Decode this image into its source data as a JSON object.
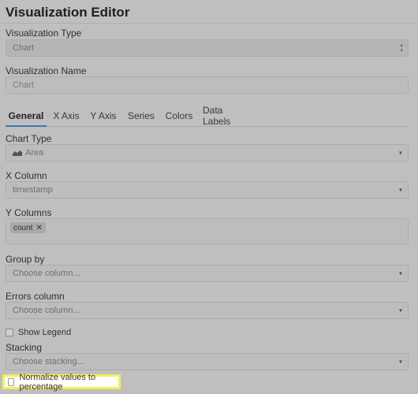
{
  "editor": {
    "title": "Visualization Editor"
  },
  "fields": {
    "viz_type_label": "Visualization Type",
    "viz_type_value": "Chart",
    "viz_name_label": "Visualization Name",
    "viz_name_placeholder": "Chart"
  },
  "tabs": [
    {
      "label": "General"
    },
    {
      "label": "X Axis"
    },
    {
      "label": "Y Axis"
    },
    {
      "label": "Series"
    },
    {
      "label": "Colors"
    },
    {
      "label": "Data Labels"
    }
  ],
  "general": {
    "chart_type_label": "Chart Type",
    "chart_type_value": "Area",
    "x_column_label": "X Column",
    "x_column_value": "timestamp",
    "y_columns_label": "Y Columns",
    "y_columns_tag": "count",
    "y_tag_remove": "✕",
    "group_by_label": "Group by",
    "group_by_placeholder": "Choose column...",
    "errors_label": "Errors column",
    "errors_placeholder": "Choose column...",
    "show_legend_label": "Show Legend",
    "stacking_label": "Stacking",
    "stacking_placeholder": "Choose stacking...",
    "normalize_label": "Normalize values to percentage"
  },
  "icons": {
    "select_caret": "▾",
    "updown_caret": "▴▾"
  },
  "colors": {
    "active_tab": "#3f74b3",
    "highlight": "#f3ef58"
  }
}
